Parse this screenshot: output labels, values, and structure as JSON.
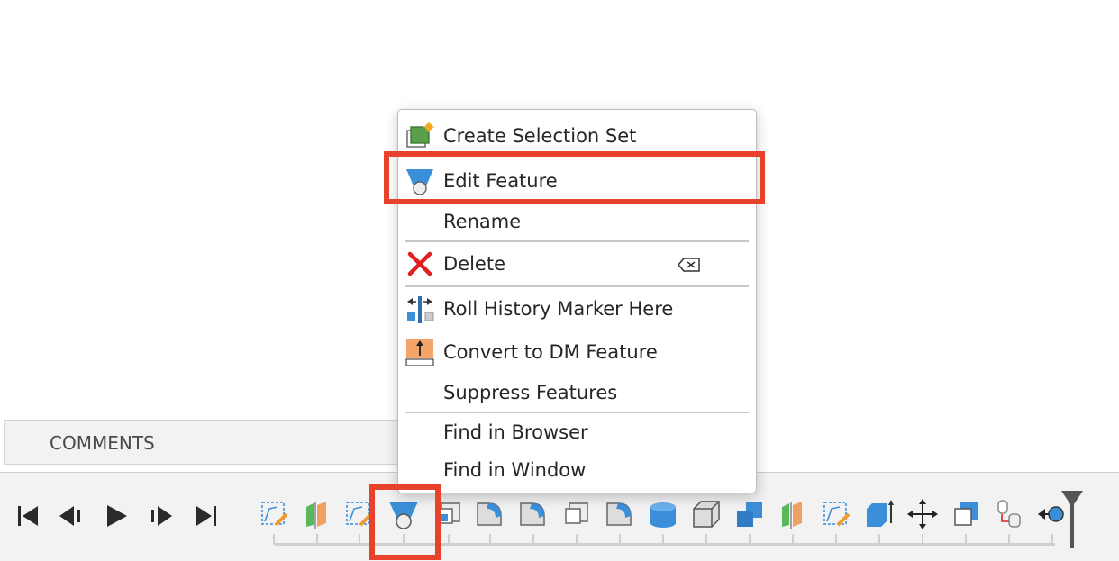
{
  "comments": {
    "label": "COMMENTS"
  },
  "context_menu": {
    "items": [
      {
        "label": "Create Selection Set",
        "icon": "selection-set-icon"
      },
      {
        "label": "Edit Feature",
        "icon": "edit-feature-icon"
      },
      {
        "label": "Rename"
      },
      {
        "label": "Delete",
        "icon": "delete-x-icon",
        "shortcut_icon": "delete-key-icon"
      },
      {
        "label": "Roll History Marker Here",
        "icon": "roll-history-icon"
      },
      {
        "label": "Convert to DM Feature",
        "icon": "convert-dm-icon"
      },
      {
        "label": "Suppress Features"
      },
      {
        "label": "Find in Browser"
      },
      {
        "label": "Find in Window"
      }
    ]
  },
  "timeline": {
    "playback_controls": [
      "skip-to-start-icon",
      "step-back-icon",
      "play-icon",
      "step-forward-icon",
      "skip-to-end-icon"
    ],
    "features": [
      "sketch-icon",
      "split-body-icon",
      "sketch-icon",
      "loft-icon",
      "shell-icon",
      "fillet-icon",
      "fillet-icon",
      "shell-icon",
      "fillet-icon",
      "cylinder-icon",
      "box-icon",
      "combine-icon",
      "split-body-icon",
      "sketch-icon",
      "extrude-icon",
      "move-icon",
      "shell-icon",
      "joint-icon",
      "history-marker-icon"
    ]
  },
  "colors": {
    "highlight": "#e8412c",
    "icon_blue": "#3b8fd9",
    "delete_red": "#e02020"
  }
}
